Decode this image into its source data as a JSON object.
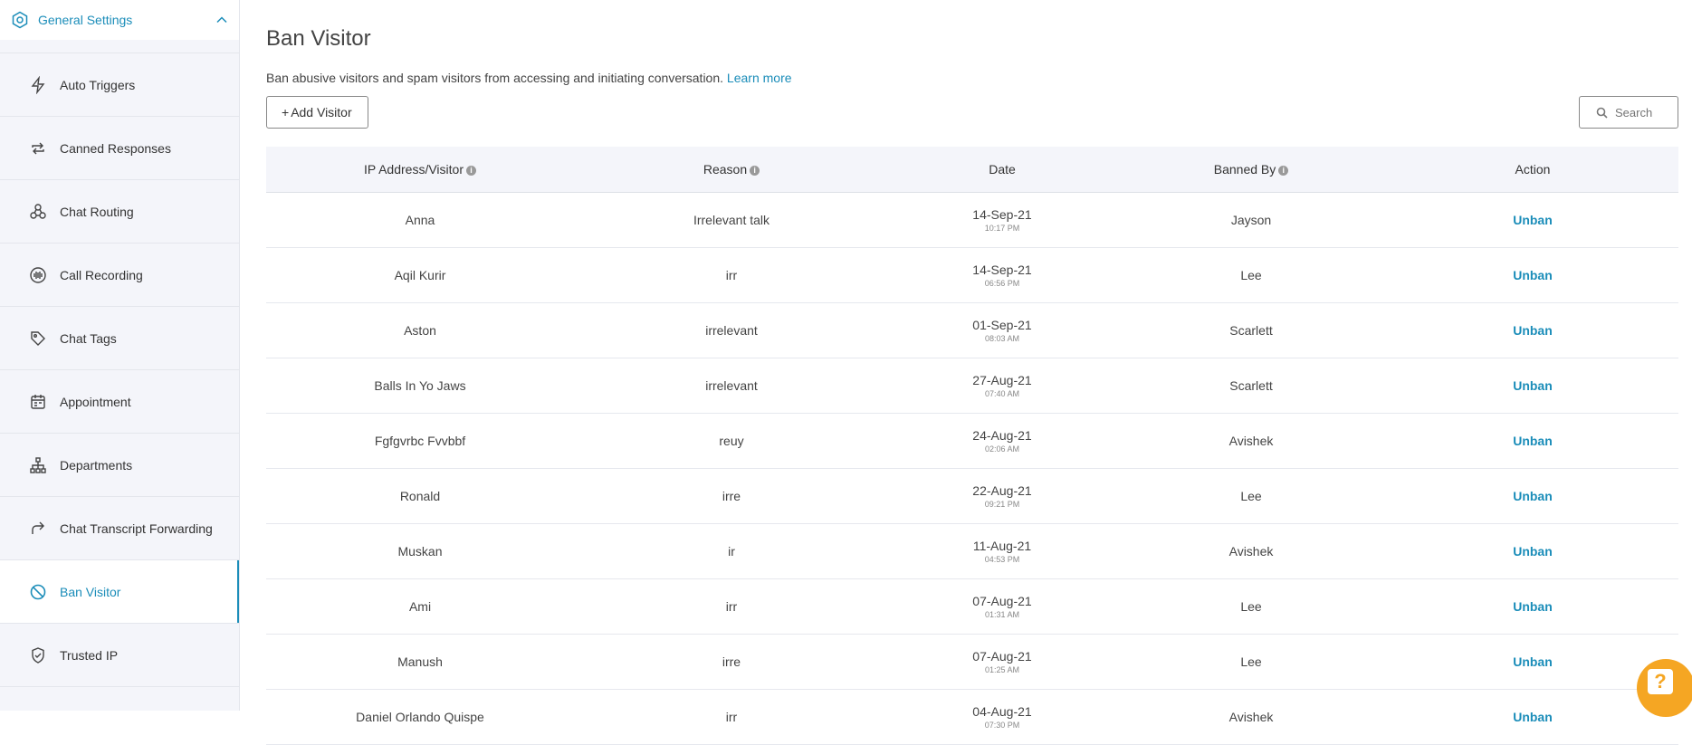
{
  "sidebar": {
    "section_title": "General Settings",
    "items": [
      {
        "label": "Auto Triggers",
        "icon": "lightning-icon"
      },
      {
        "label": "Canned Responses",
        "icon": "repeat-icon"
      },
      {
        "label": "Chat Routing",
        "icon": "routing-icon"
      },
      {
        "label": "Call Recording",
        "icon": "soundwave-icon"
      },
      {
        "label": "Chat Tags",
        "icon": "tag-icon"
      },
      {
        "label": "Appointment",
        "icon": "calendar-icon"
      },
      {
        "label": "Departments",
        "icon": "sitemap-icon"
      },
      {
        "label": "Chat Transcript Forwarding",
        "icon": "forward-arrow-icon"
      },
      {
        "label": "Ban Visitor",
        "icon": "ban-icon",
        "active": true
      },
      {
        "label": "Trusted IP",
        "icon": "shield-check-icon"
      }
    ]
  },
  "page": {
    "title": "Ban Visitor",
    "description": "Ban abusive visitors and spam visitors from accessing and initiating conversation.",
    "learn_more": "Learn more",
    "add_button": "Add Visitor",
    "add_symbol": "+",
    "search_placeholder": "Search"
  },
  "table": {
    "headers": [
      "IP Address/Visitor",
      "Reason",
      "Date",
      "Banned By",
      "Action"
    ],
    "info_symbol": "i",
    "rows": [
      {
        "visitor": "Anna",
        "reason": "Irrelevant talk",
        "date": "14-Sep-21",
        "time": "10:17 PM",
        "banned_by": "Jayson",
        "action": "Unban"
      },
      {
        "visitor": "Aqil Kurir",
        "reason": "irr",
        "date": "14-Sep-21",
        "time": "06:56 PM",
        "banned_by": "Lee",
        "action": "Unban"
      },
      {
        "visitor": "Aston",
        "reason": "irrelevant",
        "date": "01-Sep-21",
        "time": "08:03 AM",
        "banned_by": "Scarlett",
        "action": "Unban"
      },
      {
        "visitor": "Balls In Yo Jaws",
        "reason": "irrelevant",
        "date": "27-Aug-21",
        "time": "07:40 AM",
        "banned_by": "Scarlett",
        "action": "Unban"
      },
      {
        "visitor": "Fgfgvrbc Fvvbbf",
        "reason": "reuy",
        "date": "24-Aug-21",
        "time": "02:06 AM",
        "banned_by": "Avishek",
        "action": "Unban"
      },
      {
        "visitor": "Ronald",
        "reason": "irre",
        "date": "22-Aug-21",
        "time": "09:21 PM",
        "banned_by": "Lee",
        "action": "Unban"
      },
      {
        "visitor": "Muskan",
        "reason": "ir",
        "date": "11-Aug-21",
        "time": "04:53 PM",
        "banned_by": "Avishek",
        "action": "Unban"
      },
      {
        "visitor": "Ami",
        "reason": "irr",
        "date": "07-Aug-21",
        "time": "01:31 AM",
        "banned_by": "Lee",
        "action": "Unban"
      },
      {
        "visitor": "Manush",
        "reason": "irre",
        "date": "07-Aug-21",
        "time": "01:25 AM",
        "banned_by": "Lee",
        "action": "Unban"
      },
      {
        "visitor": "Daniel Orlando Quispe",
        "reason": "irr",
        "date": "04-Aug-21",
        "time": "07:30 PM",
        "banned_by": "Avishek",
        "action": "Unban"
      }
    ]
  },
  "help": {
    "symbol": "?",
    "icon": "help-icon"
  },
  "colors": {
    "accent": "#1b8db9",
    "sidebar_bg": "#f4f5fa",
    "help_bg": "#f5a623"
  }
}
